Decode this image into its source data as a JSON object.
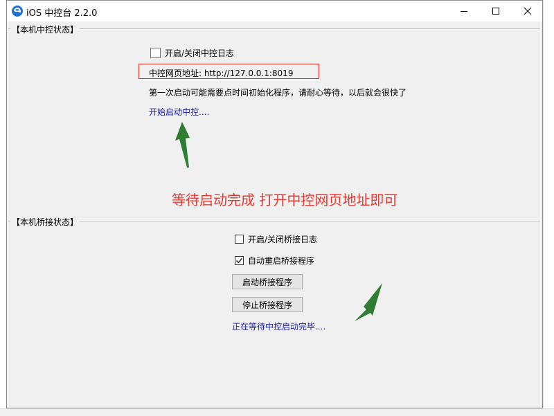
{
  "window": {
    "title": "iOS 中控台 2.2.0",
    "controls": {
      "minimize": "minimize-icon",
      "maximize": "maximize-icon",
      "close": "close-icon"
    }
  },
  "local_status": {
    "group_title": "【本机中控状态】",
    "log_toggle_label": "开启/关闭中控日志",
    "log_toggle_checked": false,
    "web_address": "中控网页地址: http://127.0.0.1:8019",
    "init_notice": "第一次启动可能需要点时间初始化程序，请耐心等待，以后就会很快了",
    "start_link": "开始启动中控...."
  },
  "annotation": "等待启动完成 打开中控网页地址即可",
  "bridge_status": {
    "group_title": "【本机桥接状态】",
    "log_toggle_label": "开启/关闭桥接日志",
    "log_toggle_checked": false,
    "auto_restart_label": "自动重启桥接程序",
    "auto_restart_checked": true,
    "start_button": "启动桥接程序",
    "stop_button": "停止桥接程序",
    "status_text": "正在等待中控启动完毕...."
  },
  "colors": {
    "annotation": "#e33a32",
    "link": "#1b1bb4",
    "highlight_box": "#e0322b",
    "arrow": "#2e7d32"
  }
}
